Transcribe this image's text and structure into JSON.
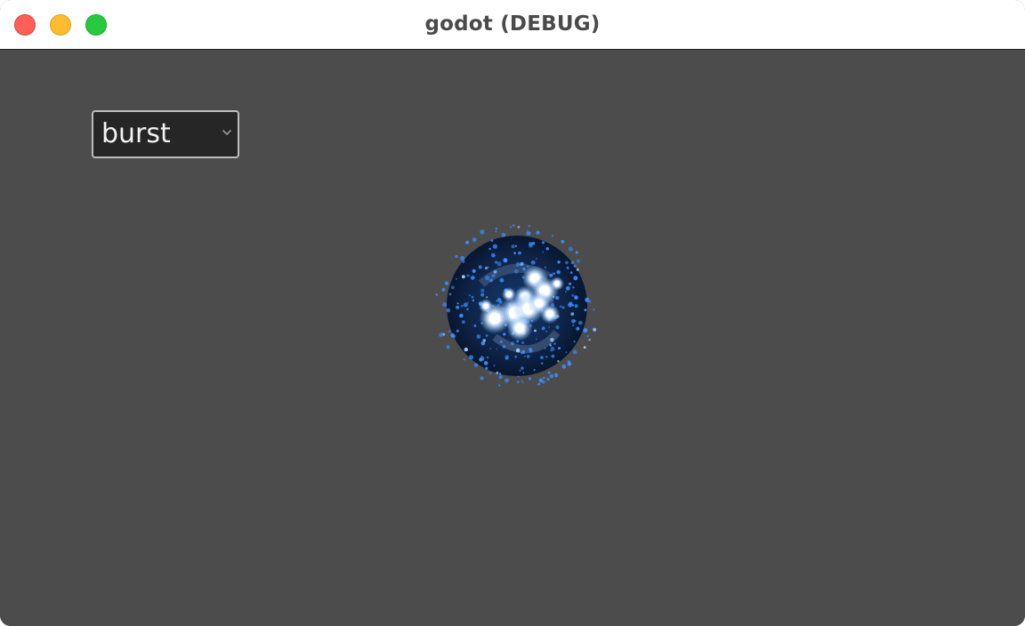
{
  "window": {
    "title": "godot (DEBUG)",
    "controls": [
      "close",
      "minimize",
      "zoom"
    ],
    "colors": {
      "close": "#fe5f57",
      "minimize": "#febc2e",
      "zoom": "#28c840",
      "viewport_background": "#4c4c4c"
    }
  },
  "option_button": {
    "selected": "burst",
    "icon": "chevron-down-icon"
  },
  "particle_effect": {
    "icon": "particle-burst-sphere",
    "colors": {
      "core": "#0b1a33",
      "particles": "#3a8dff",
      "glow": "#e8f4ff"
    }
  }
}
